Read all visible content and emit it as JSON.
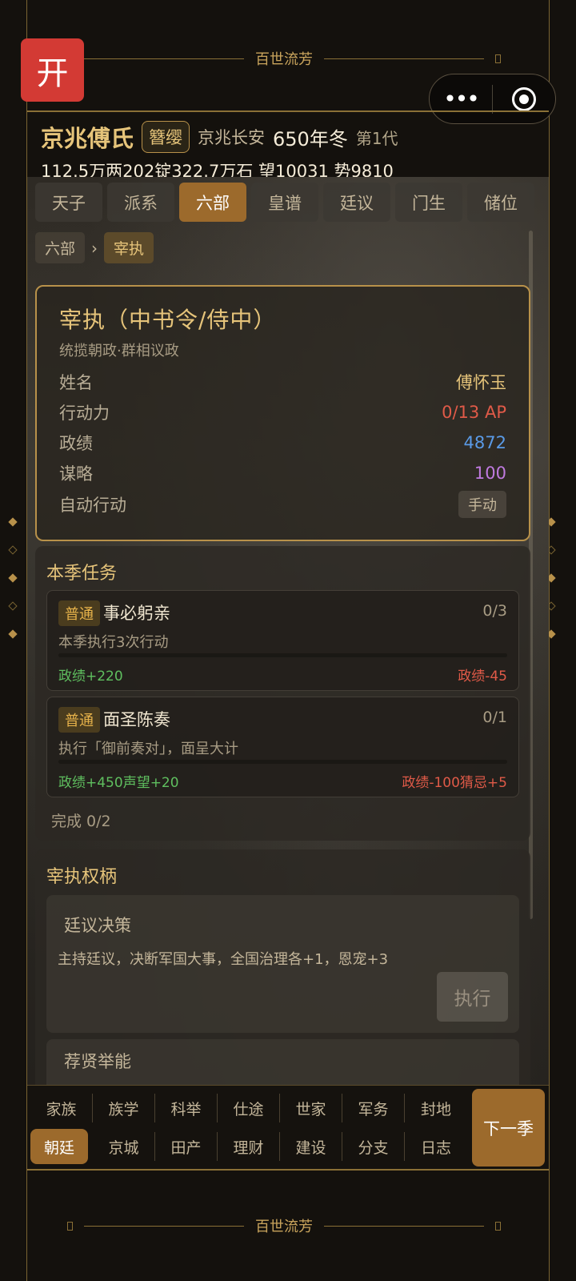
{
  "app_icon": "开",
  "title_deco": "百世流芳",
  "header": {
    "family": "京兆傅氏",
    "badge": "簪缨",
    "location": "京兆长安",
    "season": "650年冬",
    "generation": "第1代",
    "stats": "112.5万两202锭322.7万石  望10031 势9810"
  },
  "tabs": [
    "天子",
    "派系",
    "六部",
    "皇谱",
    "廷议",
    "门生",
    "储位"
  ],
  "active_tab": "六部",
  "breadcrumb": {
    "parent": "六部",
    "sep": "›",
    "current": "宰执"
  },
  "official": {
    "title": "宰执（中书令/侍中）",
    "subtitle": "统揽朝政·群相议政",
    "rows": [
      {
        "label": "姓名",
        "value": "傅怀玉",
        "color": "#e6c47a"
      },
      {
        "label": "行动力",
        "value": "0/13 AP",
        "color": "#e05a48"
      },
      {
        "label": "政绩",
        "value": "4872",
        "color": "#5a9ae6"
      },
      {
        "label": "谋略",
        "value": "100",
        "color": "#c07ae0"
      },
      {
        "label": "自动行动",
        "value": "手动"
      }
    ]
  },
  "quests": {
    "title": "本季任务",
    "items": [
      {
        "tag": "普通",
        "name": "事必躬亲",
        "progress": "0/3",
        "fraction": 0.0,
        "desc": "本季执行3次行动",
        "reward": "政绩+220",
        "penalty": "政绩-45"
      },
      {
        "tag": "普通",
        "name": "面圣陈奏",
        "progress": "0/1",
        "fraction": 0.0,
        "desc": "执行「御前奏对」，面呈大计",
        "reward": "政绩+450声望+20",
        "penalty": "政绩-100猜忌+5"
      }
    ],
    "done": "完成 0/2"
  },
  "powers": {
    "title": "宰执权柄",
    "items": [
      {
        "name": "廷议决策",
        "desc": "主持廷议，决断军国大事，全国治理各+1，恩宠+3",
        "button": "执行"
      },
      {
        "name": "荐贤举能"
      }
    ]
  },
  "bottom_nav": {
    "row1": [
      "家族",
      "族学",
      "科举",
      "仕途",
      "世家",
      "军务",
      "封地"
    ],
    "row2": [
      "朝廷",
      "京城",
      "田产",
      "理财",
      "建设",
      "分支",
      "日志"
    ],
    "active": "朝廷",
    "next_button": "下一季"
  },
  "colors": {
    "accent": "#9c6a2c",
    "gold": "#e6c47a",
    "app_red": "#d33a34"
  }
}
